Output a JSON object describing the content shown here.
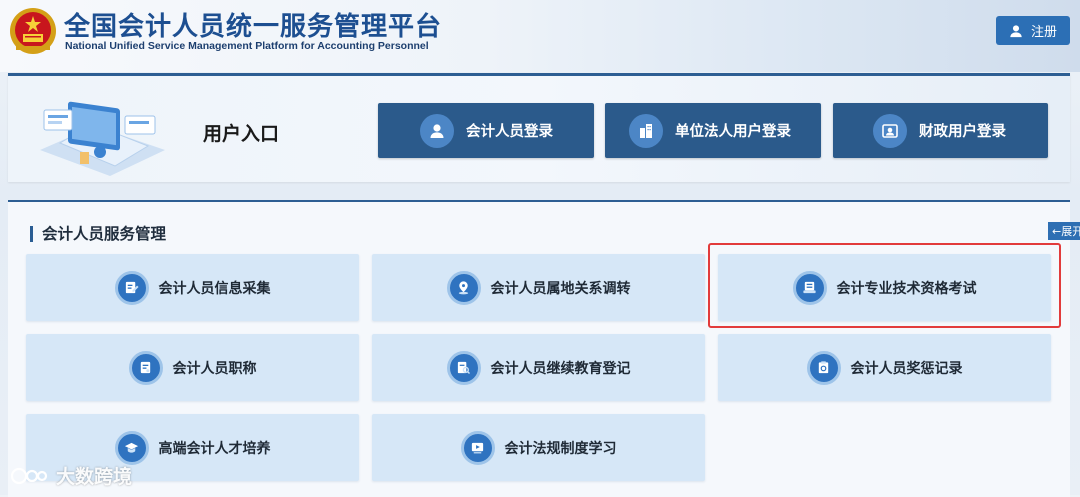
{
  "header": {
    "title": "全国会计人员统一服务管理平台",
    "subtitle": "National Unified Service Management Platform for Accounting Personnel",
    "register_label": "注册"
  },
  "entry": {
    "title": "用户入口",
    "buttons": [
      {
        "label": "会计人员登录",
        "icon": "user-icon"
      },
      {
        "label": "单位法人用户登录",
        "icon": "building-icon"
      },
      {
        "label": "财政用户登录",
        "icon": "id-card-icon"
      }
    ]
  },
  "services": {
    "title": "会计人员服务管理",
    "tiles": [
      {
        "label": "会计人员信息采集",
        "icon": "edit-doc-icon"
      },
      {
        "label": "会计人员属地关系调转",
        "icon": "location-icon"
      },
      {
        "label": "会计专业技术资格考试",
        "icon": "exam-icon"
      },
      {
        "label": "会计人员职称",
        "icon": "certificate-icon"
      },
      {
        "label": "会计人员继续教育登记",
        "icon": "search-doc-icon"
      },
      {
        "label": "会计人员奖惩记录",
        "icon": "record-icon"
      },
      {
        "label": "高端会计人才培养",
        "icon": "graduation-cap-icon"
      },
      {
        "label": "会计法规制度学习",
        "icon": "video-icon"
      }
    ]
  },
  "side_tab": {
    "label": "←展开"
  },
  "watermark": {
    "text": "大数跨境"
  },
  "colors": {
    "primary": "#2b5a8b",
    "accent": "#2f73c0",
    "tile_bg": "#d6e7f7",
    "highlight": "#e23b3b"
  }
}
